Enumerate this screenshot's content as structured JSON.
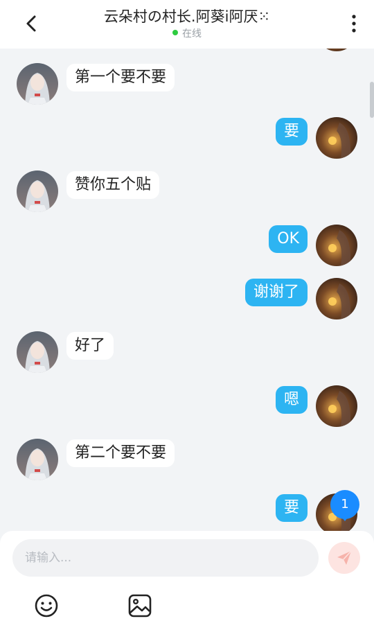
{
  "header": {
    "title": "云朵村の村长.阿葵i阿厌⁙",
    "status": "在线",
    "status_color": "#2ecc40"
  },
  "messages": [
    {
      "side": "left",
      "text": "第一个要不要"
    },
    {
      "side": "right",
      "text": "要"
    },
    {
      "side": "left",
      "text": "赞你五个贴"
    },
    {
      "side": "right",
      "text": "OK"
    },
    {
      "side": "right",
      "text": "谢谢了"
    },
    {
      "side": "left",
      "text": "好了"
    },
    {
      "side": "right",
      "text": "嗯"
    },
    {
      "side": "left",
      "text": "第二个要不要"
    },
    {
      "side": "right",
      "text": "要"
    }
  ],
  "unread_badge": "1",
  "composer": {
    "placeholder": "请输入...",
    "value": ""
  },
  "icons": {
    "back": "chevron-left-icon",
    "more": "more-vertical-icon",
    "send": "send-icon",
    "emoji": "emoji-icon",
    "image": "image-icon"
  },
  "colors": {
    "outgoing_bubble": "#2db4f2",
    "incoming_bubble": "#ffffff",
    "badge": "#1a8cff",
    "send_button": "#fde4e1"
  }
}
